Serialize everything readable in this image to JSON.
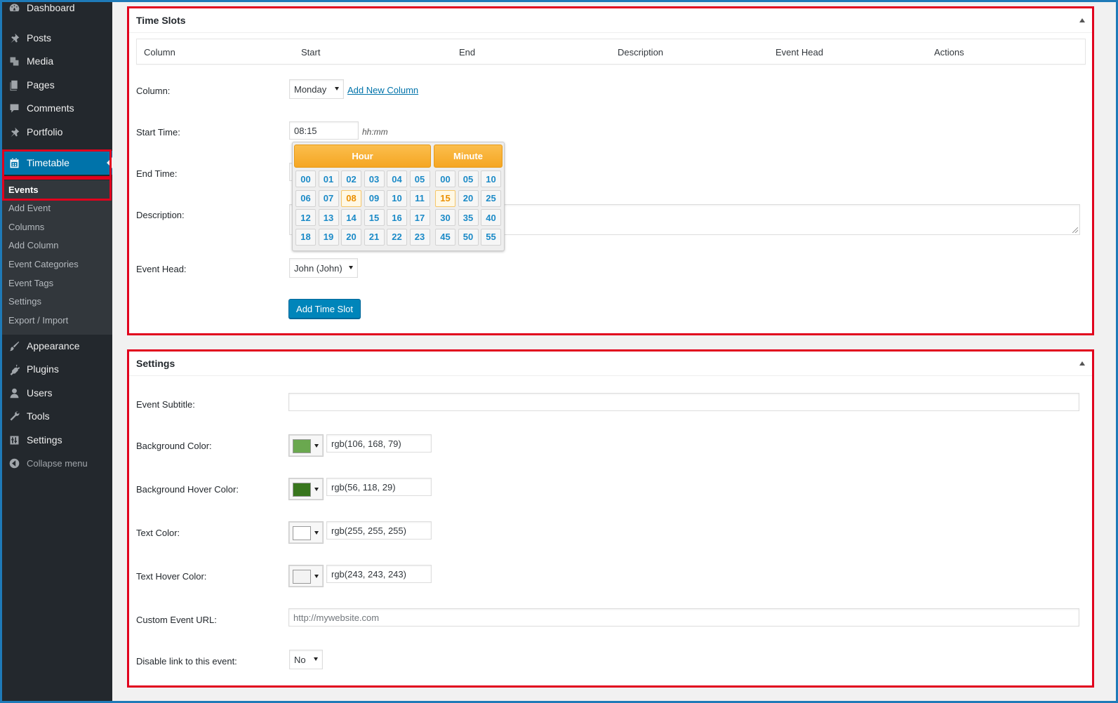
{
  "sidebar": {
    "items": [
      {
        "label": "Dashboard",
        "icon": "dashboard-icon"
      },
      {
        "label": "Posts",
        "icon": "pin-icon"
      },
      {
        "label": "Media",
        "icon": "media-icon"
      },
      {
        "label": "Pages",
        "icon": "pages-icon"
      },
      {
        "label": "Comments",
        "icon": "comments-icon"
      },
      {
        "label": "Portfolio",
        "icon": "pin-icon"
      },
      {
        "label": "Timetable",
        "icon": "calendar-icon"
      },
      {
        "label": "Appearance",
        "icon": "brush-icon"
      },
      {
        "label": "Plugins",
        "icon": "plugin-icon"
      },
      {
        "label": "Users",
        "icon": "users-icon"
      },
      {
        "label": "Tools",
        "icon": "wrench-icon"
      },
      {
        "label": "Settings",
        "icon": "settings-icon"
      },
      {
        "label": "Collapse menu",
        "icon": "collapse-icon"
      }
    ],
    "submenu": [
      "Events",
      "Add Event",
      "Columns",
      "Add Column",
      "Event Categories",
      "Event Tags",
      "Settings",
      "Export / Import"
    ]
  },
  "time_slots": {
    "title": "Time Slots",
    "table_headers": [
      "Column",
      "Start",
      "End",
      "Description",
      "Event Head",
      "Actions"
    ],
    "column_label": "Column:",
    "column_value": "Monday",
    "add_new_column": "Add New Column",
    "start_label": "Start Time:",
    "start_value": "08:15",
    "start_hint": "hh:mm",
    "end_label": "End Time:",
    "description_label": "Description:",
    "event_head_label": "Event Head:",
    "event_head_value": "John (John)",
    "add_button": "Add Time Slot"
  },
  "timepicker": {
    "hour_title": "Hour",
    "minute_title": "Minute",
    "hours": [
      "00",
      "01",
      "02",
      "03",
      "04",
      "05",
      "06",
      "07",
      "08",
      "09",
      "10",
      "11",
      "12",
      "13",
      "14",
      "15",
      "16",
      "17",
      "18",
      "19",
      "20",
      "21",
      "22",
      "23"
    ],
    "minutes": [
      "00",
      "05",
      "10",
      "15",
      "20",
      "25",
      "30",
      "35",
      "40",
      "45",
      "50",
      "55"
    ],
    "selected_hour": "08",
    "selected_minute": "15"
  },
  "settings": {
    "title": "Settings",
    "subtitle_label": "Event Subtitle:",
    "bg_color_label": "Background Color:",
    "bg_color_value": "rgb(106, 168, 79)",
    "bg_hover_label": "Background Hover Color:",
    "bg_hover_value": "rgb(56, 118, 29)",
    "text_color_label": "Text Color:",
    "text_color_value": "rgb(255, 255, 255)",
    "text_hover_label": "Text Hover Color:",
    "text_hover_value": "rgb(243, 243, 243)",
    "url_label": "Custom Event URL:",
    "url_placeholder": "http://mywebsite.com",
    "disable_label": "Disable link to this event:",
    "disable_value": "No"
  },
  "colors": {
    "swatch_bg": "#6aa84f",
    "swatch_bg_hover": "#38761d",
    "swatch_text": "#ffffff",
    "swatch_text_hover": "#f3f3f3"
  }
}
